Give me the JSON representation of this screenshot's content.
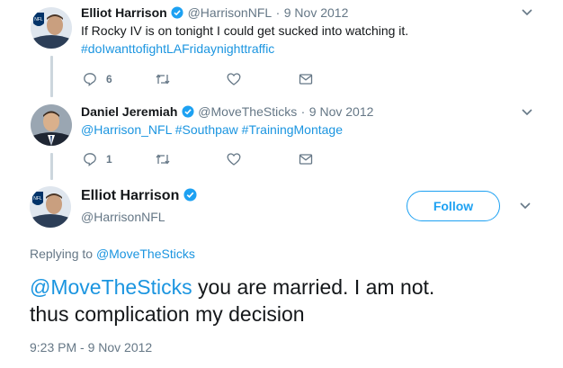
{
  "tweet1": {
    "name": "Elliot Harrison",
    "handle": "@HarrisonNFL",
    "date": "9 Nov 2012",
    "text": "If Rocky IV is on tonight I could get sucked into watching it.",
    "hashtag": "#doIwanttofightLAFridaynighttraffic",
    "reply_count": "6"
  },
  "tweet2": {
    "name": "Daniel Jeremiah",
    "handle": "@MoveTheSticks",
    "date": "9 Nov 2012",
    "mention": "@Harrison_NFL",
    "tags": "#Southpaw #TrainingMontage",
    "reply_count": "1"
  },
  "main": {
    "name": "Elliot Harrison",
    "handle": "@HarrisonNFL",
    "follow_label": "Follow",
    "replying_prefix": "Replying to",
    "replying_handle": "@MoveTheSticks",
    "mention": "@MoveTheSticks",
    "text_line1": "you are married. I am not.",
    "text_line2": "thus complication my decision",
    "timestamp": "9:23 PM - 9 Nov 2012"
  },
  "colors": {
    "link": "#1b95e0",
    "muted": "#657786",
    "thread_line": "#ccd6dd"
  },
  "icons": [
    "reply-icon",
    "retweet-icon",
    "like-icon",
    "message-icon",
    "verified-icon",
    "chevron-down-icon"
  ]
}
